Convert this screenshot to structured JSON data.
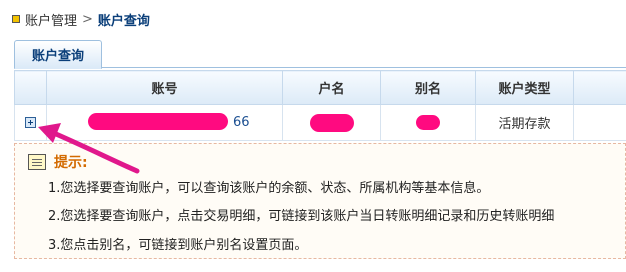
{
  "breadcrumb": {
    "parent": "账户管理",
    "separator": ">",
    "current": "账户查询"
  },
  "tab": {
    "label": "账户查询"
  },
  "table": {
    "columns": [
      "账号",
      "户名",
      "别名",
      "账户类型"
    ],
    "rows": [
      {
        "account_visible": "66",
        "name": "",
        "alias": "",
        "type": "活期存款"
      }
    ]
  },
  "tips": {
    "title": "提示:",
    "lines": [
      "1.您选择要查询账户，可以查询该账户的余额、状态、所属机构等基本信息。",
      "2.您选择要查询账户，点击交易明细，可链接到该账户当日转账明细记录和历史转账明细",
      "3.您点击别名，可链接到账户别名设置页面。"
    ]
  },
  "colors": {
    "annotation": "#e0188c",
    "redaction": "#ff0a80",
    "link": "#1b4f91",
    "tip_title": "#d36a00"
  }
}
